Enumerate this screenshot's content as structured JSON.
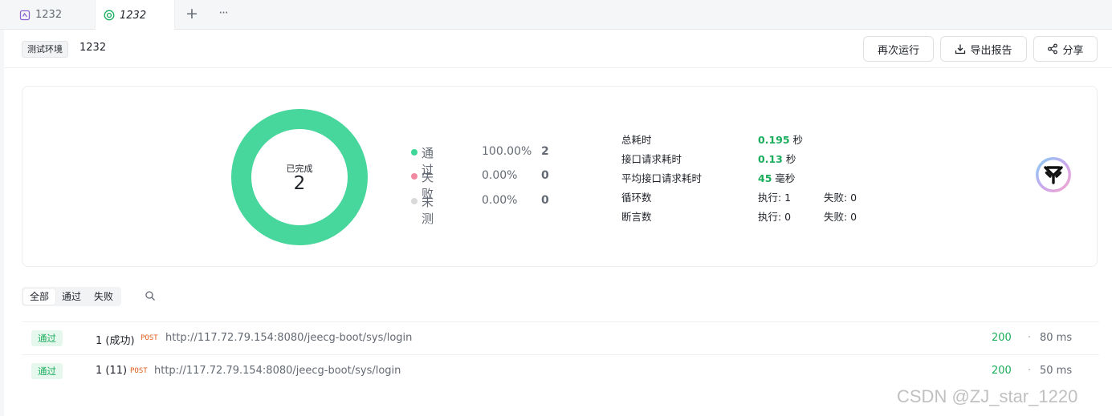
{
  "tabs": [
    {
      "label": "1232",
      "icon": "api-scenario-icon"
    },
    {
      "label": "1232",
      "icon": "report-icon",
      "active": true
    }
  ],
  "tab_add_label": "+",
  "tab_more_label": "···",
  "header": {
    "env_tag": "测试环境",
    "report_name": "1232",
    "rerun_label": "再次运行",
    "export_label": "导出报告",
    "share_label": "分享"
  },
  "summary": {
    "donut_label": "已完成",
    "donut_count": "2",
    "legend": [
      {
        "name": "通过",
        "percent": "100.00%",
        "count": "2",
        "color": "#3dd598"
      },
      {
        "name": "失败",
        "percent": "0.00%",
        "count": "0",
        "color": "#f08ba3"
      },
      {
        "name": "未测",
        "percent": "0.00%",
        "count": "0",
        "color": "#d9d9d9"
      }
    ],
    "pass_fraction": 1.0,
    "stats": {
      "total_time_label": "总耗时",
      "total_time_value": "0.195",
      "total_time_unit": "秒",
      "request_time_label": "接口请求耗时",
      "request_time_value": "0.13",
      "request_time_unit": "秒",
      "avg_time_label": "平均接口请求耗时",
      "avg_time_value": "45",
      "avg_time_unit": "毫秒",
      "loop_label": "循环数",
      "loop_exec": "执行: 1",
      "loop_fail": "失败: 0",
      "assert_label": "断言数",
      "assert_exec": "执行: 0",
      "assert_fail": "失败: 0"
    }
  },
  "filters": {
    "all": "全部",
    "pass": "通过",
    "fail": "失败"
  },
  "rows": [
    {
      "badge": "通过",
      "name": "1 (成功)",
      "method": "POST",
      "url": "http://117.72.79.154:8080/jeecg-boot/sys/login",
      "status": "200",
      "sep": "·",
      "time": "80 ms"
    },
    {
      "badge": "通过",
      "name": "1 (11)",
      "method": "POST",
      "url": "http://117.72.79.154:8080/jeecg-boot/sys/login",
      "status": "200",
      "sep": "·",
      "time": "50 ms"
    }
  ],
  "watermark": "CSDN @ZJ_star_1220",
  "colors": {
    "accent": "#1aad5b",
    "donut": "#47d69c",
    "method": "#e05b1b"
  }
}
